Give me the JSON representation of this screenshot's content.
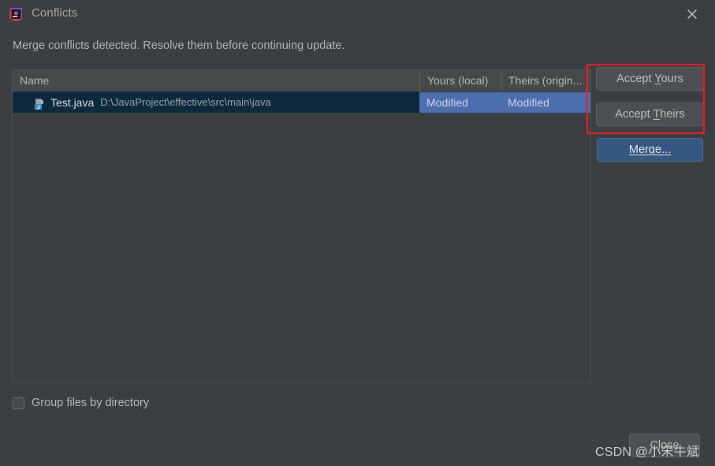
{
  "window": {
    "title": "Conflicts",
    "app_icon": "intellij-idea-logo",
    "close_icon": "close-icon"
  },
  "message": "Merge conflicts detected. Resolve them before continuing update.",
  "table": {
    "columns": [
      {
        "key": "name",
        "label": "Name"
      },
      {
        "key": "yours",
        "label": "Yours (local)"
      },
      {
        "key": "theirs",
        "label": "Theirs (origin..."
      }
    ],
    "rows": [
      {
        "icon": "java-file-icon",
        "file_name": "Test.java",
        "file_path": "D:\\JavaProject\\effective\\src\\main\\java",
        "yours": "Modified",
        "theirs": "Modified",
        "selected": true
      }
    ]
  },
  "buttons": {
    "accept_yours": {
      "prefix": "Accept ",
      "mnemonic": "Y",
      "suffix": "ours"
    },
    "accept_theirs": {
      "prefix": "Accept ",
      "mnemonic": "T",
      "suffix": "heirs"
    },
    "merge": {
      "label": "Merge..."
    },
    "close": {
      "label": "Close"
    }
  },
  "options": {
    "group_files_by_directory": {
      "label": "Group files by directory",
      "checked": false
    }
  },
  "annotation": {
    "color": "#ee1c22",
    "targets": "accept-yours-and-accept-theirs"
  },
  "watermark": "CSDN @小宋牛斌",
  "colors": {
    "window_bg": "#3c3f41",
    "panel_border": "#4f5254",
    "header_bg": "#45494a",
    "row_selected_name_bg": "#0d293e",
    "row_selected_status_bg": "#4b6eaf",
    "default_button_bg": "#365880",
    "secondary_button_bg": "#4c5052",
    "annotation_red": "#ee1c22"
  }
}
